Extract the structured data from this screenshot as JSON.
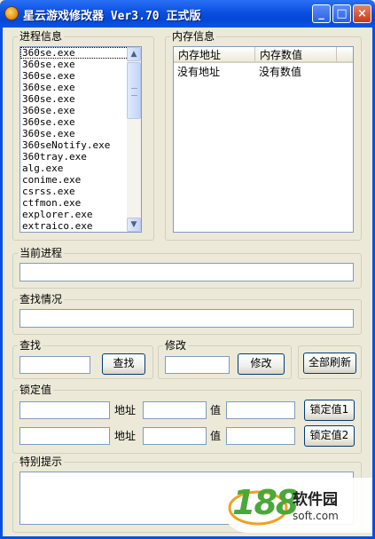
{
  "window": {
    "title": "星云游戏修改器 Ver3.70 正式版",
    "controls": {
      "minimize": "_",
      "maximize": "□",
      "close": "×"
    }
  },
  "process_group": {
    "label": "进程信息",
    "items": [
      "360se.exe",
      "360se.exe",
      "360se.exe",
      "360se.exe",
      "360se.exe",
      "360se.exe",
      "360se.exe",
      "360se.exe",
      "360seNotify.exe",
      "360tray.exe",
      "alg.exe",
      "conime.exe",
      "csrss.exe",
      "ctfmon.exe",
      "explorer.exe",
      "extraico.exe"
    ],
    "scroll_up": "▲",
    "scroll_down": "▼"
  },
  "memory_group": {
    "label": "内存信息",
    "columns": [
      "内存地址",
      "内存数值"
    ],
    "rows": [
      [
        "没有地址",
        "没有数值"
      ]
    ]
  },
  "current_process": {
    "label": "当前进程",
    "value": ""
  },
  "search_status": {
    "label": "查找情况",
    "value": ""
  },
  "search": {
    "label": "查找",
    "value": "",
    "button": "查找"
  },
  "modify": {
    "label": "修改",
    "value": "",
    "button": "修改"
  },
  "refresh_all": "全部刷新",
  "lock": {
    "label": "锁定值",
    "address_label": "地址",
    "value_label": "值",
    "rows": [
      {
        "name_value": "",
        "address": "",
        "value": "",
        "button": "锁定值1"
      },
      {
        "name_value": "",
        "address": "",
        "value": "",
        "button": "锁定值2"
      }
    ]
  },
  "notice": {
    "label": "特别提示",
    "value": ""
  },
  "watermark": {
    "number": "188",
    "site_name": "软件园",
    "url": "soft.com"
  },
  "colors": {
    "titlebar": "#0a50e0",
    "face": "#ece9d8",
    "watermark_green": "#4aa83a"
  }
}
